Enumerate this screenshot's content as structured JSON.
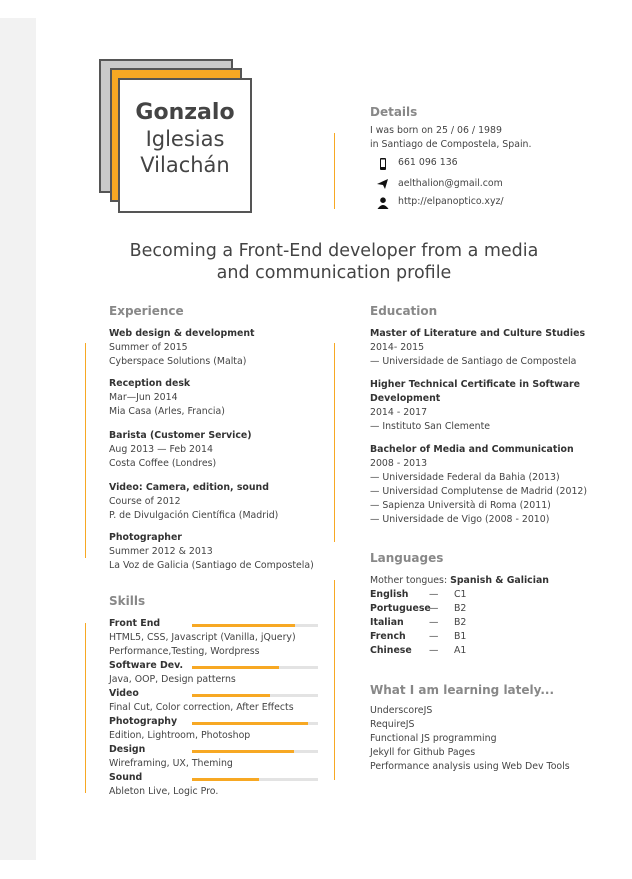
{
  "name": {
    "first": "Gonzalo",
    "last1": "Iglesias",
    "last2": "Vilachán"
  },
  "details": {
    "heading": "Details",
    "born_line1": "I was born on 25 / 06 / 1989",
    "born_line2": "in Santiago de Compostela, Spain.",
    "phone": "661 096 136",
    "email": "aelthalion@gmail.com",
    "web": "http://elpanoptico.xyz/"
  },
  "title_line1": "Becoming a Front-End developer from a media",
  "title_line2": "and communication profile",
  "experience": {
    "heading": "Experience",
    "items": [
      {
        "role": "Web design & development",
        "date": "Summer of 2015",
        "place": "Cyberspace Solutions (Malta)"
      },
      {
        "role": "Reception desk",
        "date": "Mar—Jun 2014",
        "place": "Mia Casa (Arles, Francia)"
      },
      {
        "role": "Barista (Customer Service)",
        "date": "Aug 2013 — Feb 2014",
        "place": "Costa Coffee (Londres)"
      },
      {
        "role": "Video: Camera, edition, sound",
        "date": "Course of 2012",
        "place": "P. de Divulgación Científica (Madrid)"
      },
      {
        "role": "Photographer",
        "date": "Summer 2012 & 2013",
        "place": "La Voz de Galicia (Santiago de Compostela)"
      }
    ]
  },
  "skills": {
    "heading": "Skills",
    "items": [
      {
        "name": "Front End",
        "desc": "HTML5, CSS, Javascript (Vanilla, jQuery)",
        "desc2": "Performance,Testing, Wordpress",
        "level": 0.82
      },
      {
        "name": "Software Dev.",
        "desc": "Java, OOP, Design patterns",
        "desc2": "",
        "level": 0.69
      },
      {
        "name": "Video",
        "desc": "Final Cut,  Color correction, After Effects",
        "desc2": "",
        "level": 0.62
      },
      {
        "name": "Photography",
        "desc": "Edition, Lightroom, Photoshop",
        "desc2": "",
        "level": 0.92
      },
      {
        "name": "Design",
        "desc": "Wireframing, UX, Theming",
        "desc2": "",
        "level": 0.81
      },
      {
        "name": "Sound",
        "desc": "Ableton Live, Logic Pro.",
        "desc2": "",
        "level": 0.53
      }
    ]
  },
  "education": {
    "heading": "Education",
    "items": [
      {
        "title": "Master of Literature and Culture Studies",
        "title2": "",
        "date": "2014- 2015",
        "lines": [
          "— Universidade de Santiago de Compostela"
        ]
      },
      {
        "title": "Higher Technical Certificate in Software",
        "title2": "Development",
        "date": "2014 - 2017",
        "lines": [
          "— Instituto San Clemente"
        ]
      },
      {
        "title": "Bachelor of Media and Communication",
        "title2": "",
        "date": "2008 - 2013",
        "lines": [
          "— Universidade Federal da Bahia (2013)",
          "— Universidad Complutense de Madrid (2012)",
          "— Sapienza Università di Roma (2011)",
          "— Universidade de Vigo (2008 - 2010)"
        ]
      }
    ]
  },
  "languages": {
    "heading": "Languages",
    "mother_label": "Mother tongues:",
    "mother_value": "Spanish & Galician",
    "items": [
      {
        "lang": "English",
        "dash": "—",
        "level": "C1"
      },
      {
        "lang": "Portuguese",
        "dash": "—",
        "level": "B2"
      },
      {
        "lang": "Italian",
        "dash": "—",
        "level": "B2"
      },
      {
        "lang": "French",
        "dash": "—",
        "level": "B1"
      },
      {
        "lang": "Chinese",
        "dash": "—",
        "level": "A1"
      }
    ]
  },
  "learning": {
    "heading": "What I am learning lately...",
    "items": [
      "UnderscoreJS",
      "RequireJS",
      "Functional JS programming",
      "Jekyll for Github Pages",
      "Performance analysis using Web Dev Tools"
    ]
  },
  "colors": {
    "accent": "#f7a823",
    "gray": "#c9c9c9",
    "text": "#444444"
  },
  "icons": [
    "phone-icon",
    "paper-plane-icon",
    "user-icon"
  ]
}
